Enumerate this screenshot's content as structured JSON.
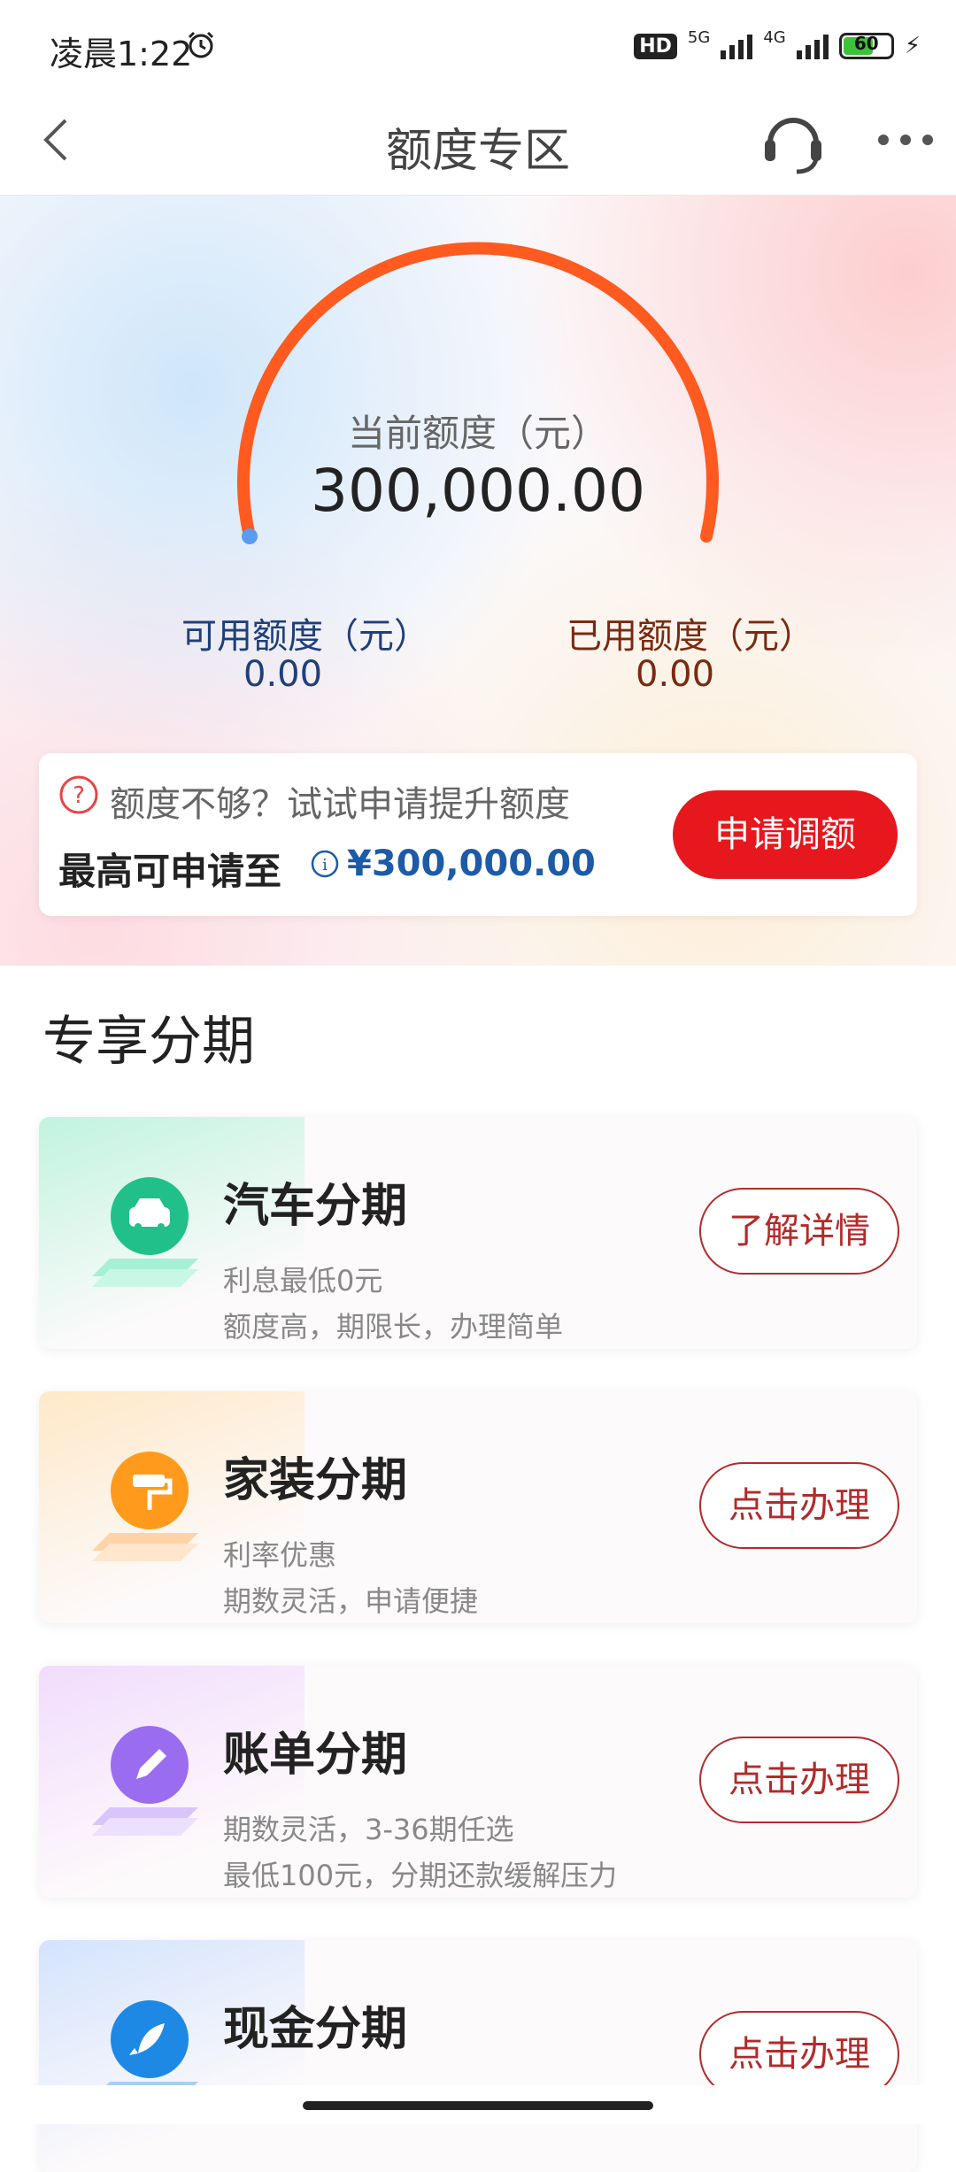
{
  "status_bar": {
    "time": "凌晨1:22",
    "hd": "HD",
    "net1": "5G",
    "net2": "4G",
    "battery": "60"
  },
  "nav": {
    "title": "额度专区"
  },
  "quota": {
    "current_label": "当前额度（元）",
    "current_value": "300,000.00",
    "available_label": "可用额度（元）",
    "available_value": "0.00",
    "used_label": "已用额度（元）",
    "used_value": "0.00",
    "arc_color": "#ff5a1f"
  },
  "apply": {
    "hint": "额度不够？试试申请提升额度",
    "max_label": "最高可申请至",
    "max_amount": "¥300,000.00",
    "button": "申请调额"
  },
  "section": {
    "title": "专享分期"
  },
  "products": [
    {
      "title": "汽车分期",
      "line1": "利息最低0元",
      "line2": "额度高，期限长，办理简单",
      "button": "了解详情",
      "icon": "car-icon",
      "color": "#21c08a"
    },
    {
      "title": "家装分期",
      "line1": "利率优惠",
      "line2": "期数灵活，申请便捷",
      "button": "点击办理",
      "icon": "paint-roller-icon",
      "color": "#ff9a1c"
    },
    {
      "title": "账单分期",
      "line1": "期数灵活，3-36期任选",
      "line2": "最低100元，分期还款缓解压力",
      "button": "点击办理",
      "icon": "pen-icon",
      "color": "#9a6df0"
    },
    {
      "title": "现金分期",
      "line1": "",
      "line2": "",
      "button": "点击办理",
      "icon": "rocket-icon",
      "color": "#1e88e5"
    }
  ]
}
